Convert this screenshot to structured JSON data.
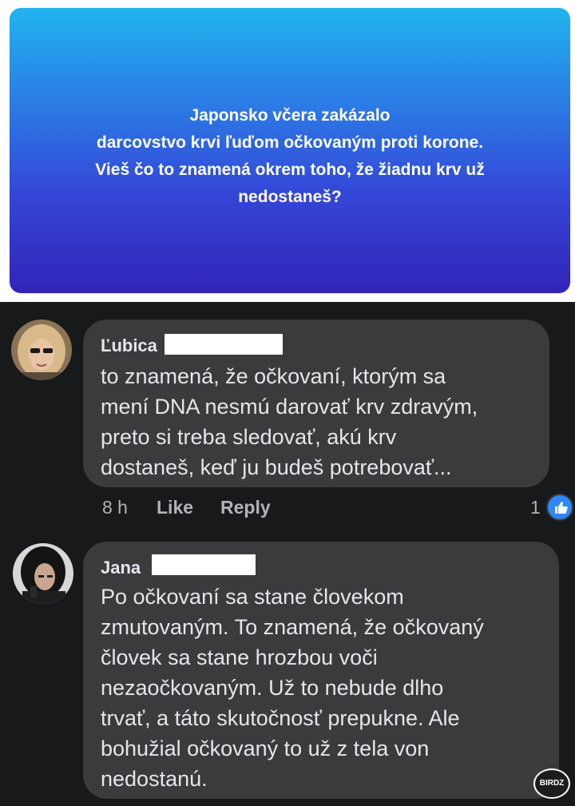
{
  "post": {
    "lines": [
      "Japonsko včera zakázalo",
      "darcovstvo krvi ľuďom očkovaným proti korone.",
      "Vieš čo to znamená okrem toho, že žiadnu krv už",
      "nedostaneš?"
    ]
  },
  "comments": [
    {
      "author": "Ľubica",
      "lines": [
        "to znamená, že očkovaní, ktorým sa",
        "mení DNA nesmú darovať krv zdravým,",
        "preto si treba sledovať, akú krv",
        "dostaneš, keď  ju budeš potrebovať..."
      ],
      "time": "8 h",
      "like_label": "Like",
      "reply_label": "Reply",
      "reaction_count": "1",
      "reaction_icon": "thumbs-up-icon"
    },
    {
      "author": "Jana",
      "lines": [
        "Po očkovaní sa stane človekom",
        "zmutovaným. To znamená, že očkovaný",
        "človek sa stane hrozbou voči",
        "nezaočkovaným. Už to nebude dlho",
        "trvať, a táto skutočnosť prepukne. Ale",
        "bohužial očkovaný to už z tela von",
        "nedostanú."
      ]
    }
  ],
  "watermark": "BIRDZ",
  "colors": {
    "bubble": "#3a3b3c",
    "background": "#18191a",
    "text": "#e4e6eb",
    "muted": "#b0b3b8",
    "like_blue": "#2d88ff"
  }
}
